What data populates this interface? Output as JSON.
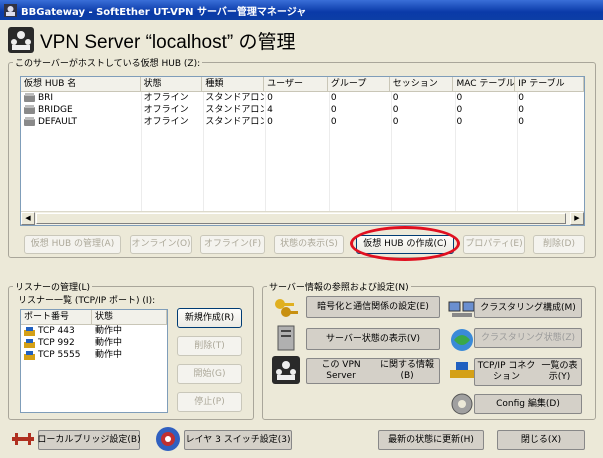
{
  "window": {
    "title": "BBGateway - SoftEther UT-VPN サーバー管理マネージャ"
  },
  "header": {
    "title": "VPN Server “localhost” の管理"
  },
  "hubs": {
    "legend": "このサーバーがホストしている仮想 HUB (Z):",
    "columns": [
      "仮想 HUB 名",
      "状態",
      "種類",
      "ユーザー",
      "グループ",
      "セッション",
      "MAC テーブル",
      "IP テーブル"
    ],
    "rows": [
      [
        "BRI",
        "オフライン",
        "スタンドアロン",
        "0",
        "0",
        "0",
        "0",
        "0"
      ],
      [
        "BRIDGE",
        "オフライン",
        "スタンドアロン",
        "4",
        "0",
        "0",
        "0",
        "0"
      ],
      [
        "DEFAULT",
        "オフライン",
        "スタンドアロン",
        "0",
        "0",
        "0",
        "0",
        "0"
      ]
    ],
    "buttons": {
      "manage": "仮想 HUB の管理(A)",
      "online": "オンライン(O)",
      "offline": "オフライン(F)",
      "status": "状態の表示(S)",
      "create": "仮想 HUB の作成(C)",
      "properties": "プロパティ(E)",
      "delete": "削除(D)"
    }
  },
  "listener": {
    "legend": "リスナーの管理(L)",
    "list_label": "リスナー一覧 (TCP/IP ポート) (I):",
    "columns": [
      "ポート番号",
      "状態"
    ],
    "rows": [
      [
        "TCP 443",
        "動作中"
      ],
      [
        "TCP 992",
        "動作中"
      ],
      [
        "TCP 5555",
        "動作中"
      ]
    ],
    "buttons": {
      "new": "新規作成(R)",
      "delete": "削除(T)",
      "start": "開始(G)",
      "stop": "停止(P)"
    }
  },
  "server_info": {
    "legend": "サーバー情報の参照および設定(N)",
    "buttons": {
      "encryption": "暗号化と通信関係の設定(E)",
      "status": "サーバー状態の表示(V)",
      "about_line1": "この VPN Server",
      "about_line2": "に関する情報(B)",
      "clustering": "クラスタリング構成(M)",
      "clustering_status": "クラスタリング状態(Z)",
      "tcpip_line1": "TCP/IP コネクション",
      "tcpip_line2": "一覧の表示(Y)",
      "config": "Config 編集(D)"
    }
  },
  "bottom": {
    "local_bridge": "ローカルブリッジ設定(B)",
    "layer3": "レイヤ 3 スイッチ設定(3)",
    "refresh": "最新の状態に更新(H)",
    "close": "閉じる(X)"
  },
  "colors": {
    "highlight": "#e01020",
    "titlebar": "#0a3aa8"
  }
}
